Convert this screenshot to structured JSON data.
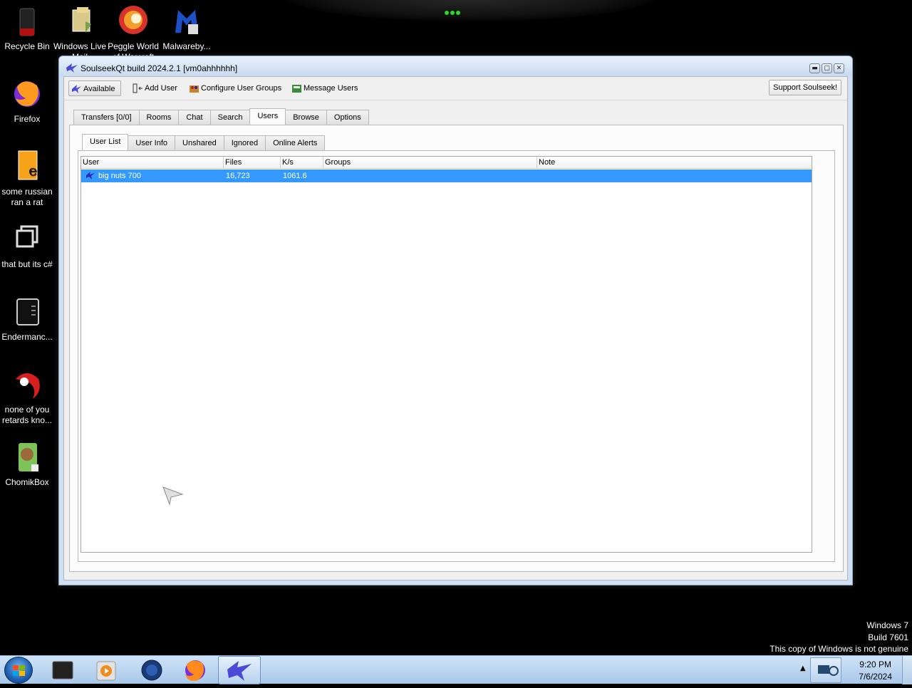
{
  "desktop": {
    "icons": [
      {
        "label": "Recycle Bin"
      },
      {
        "label": "Windows Live Mail"
      },
      {
        "label": "Peggle World of Warcraft"
      },
      {
        "label": "Malwareby..."
      },
      {
        "label": "Firefox"
      },
      {
        "label": "some russian ran a rat"
      },
      {
        "label": "that but its c#"
      },
      {
        "label": "Endermanc..."
      },
      {
        "label": "none of you retards kno..."
      },
      {
        "label": "ChomikBox"
      }
    ]
  },
  "window": {
    "title": "SoulseekQt build 2024.2.1 [vm0ahhhhhh]",
    "toolbar": {
      "status_label": "Available",
      "add_user_label": "Add User",
      "configure_groups_label": "Configure User Groups",
      "message_users_label": "Message Users",
      "support_label": "Support Soulseek!"
    },
    "main_tabs": [
      {
        "label": "Transfers [0/0]"
      },
      {
        "label": "Rooms"
      },
      {
        "label": "Chat"
      },
      {
        "label": "Search"
      },
      {
        "label": "Users"
      },
      {
        "label": "Browse"
      },
      {
        "label": "Options"
      }
    ],
    "active_main_tab": "Users",
    "sub_tabs": [
      {
        "label": "User List"
      },
      {
        "label": "User Info"
      },
      {
        "label": "Unshared"
      },
      {
        "label": "Ignored"
      },
      {
        "label": "Online Alerts"
      }
    ],
    "active_sub_tab": "User List",
    "table": {
      "columns": [
        "User",
        "Files",
        "K/s",
        "Groups",
        "Note"
      ],
      "rows": [
        {
          "user": "big nuts 700",
          "files": "16,723",
          "kps": "1061.6",
          "groups": "",
          "note": ""
        }
      ],
      "selection_color": "#3399ff"
    }
  },
  "watermark": {
    "line1": "Windows 7",
    "line2": "Build 7601",
    "line3": "This copy of Windows is not genuine"
  },
  "taskbar": {
    "items": [
      "terminal-icon",
      "media-player-icon",
      "globe-icon",
      "firefox-icon",
      "soulseek-icon"
    ],
    "time": "9:20 PM",
    "date": "7/6/2024"
  }
}
